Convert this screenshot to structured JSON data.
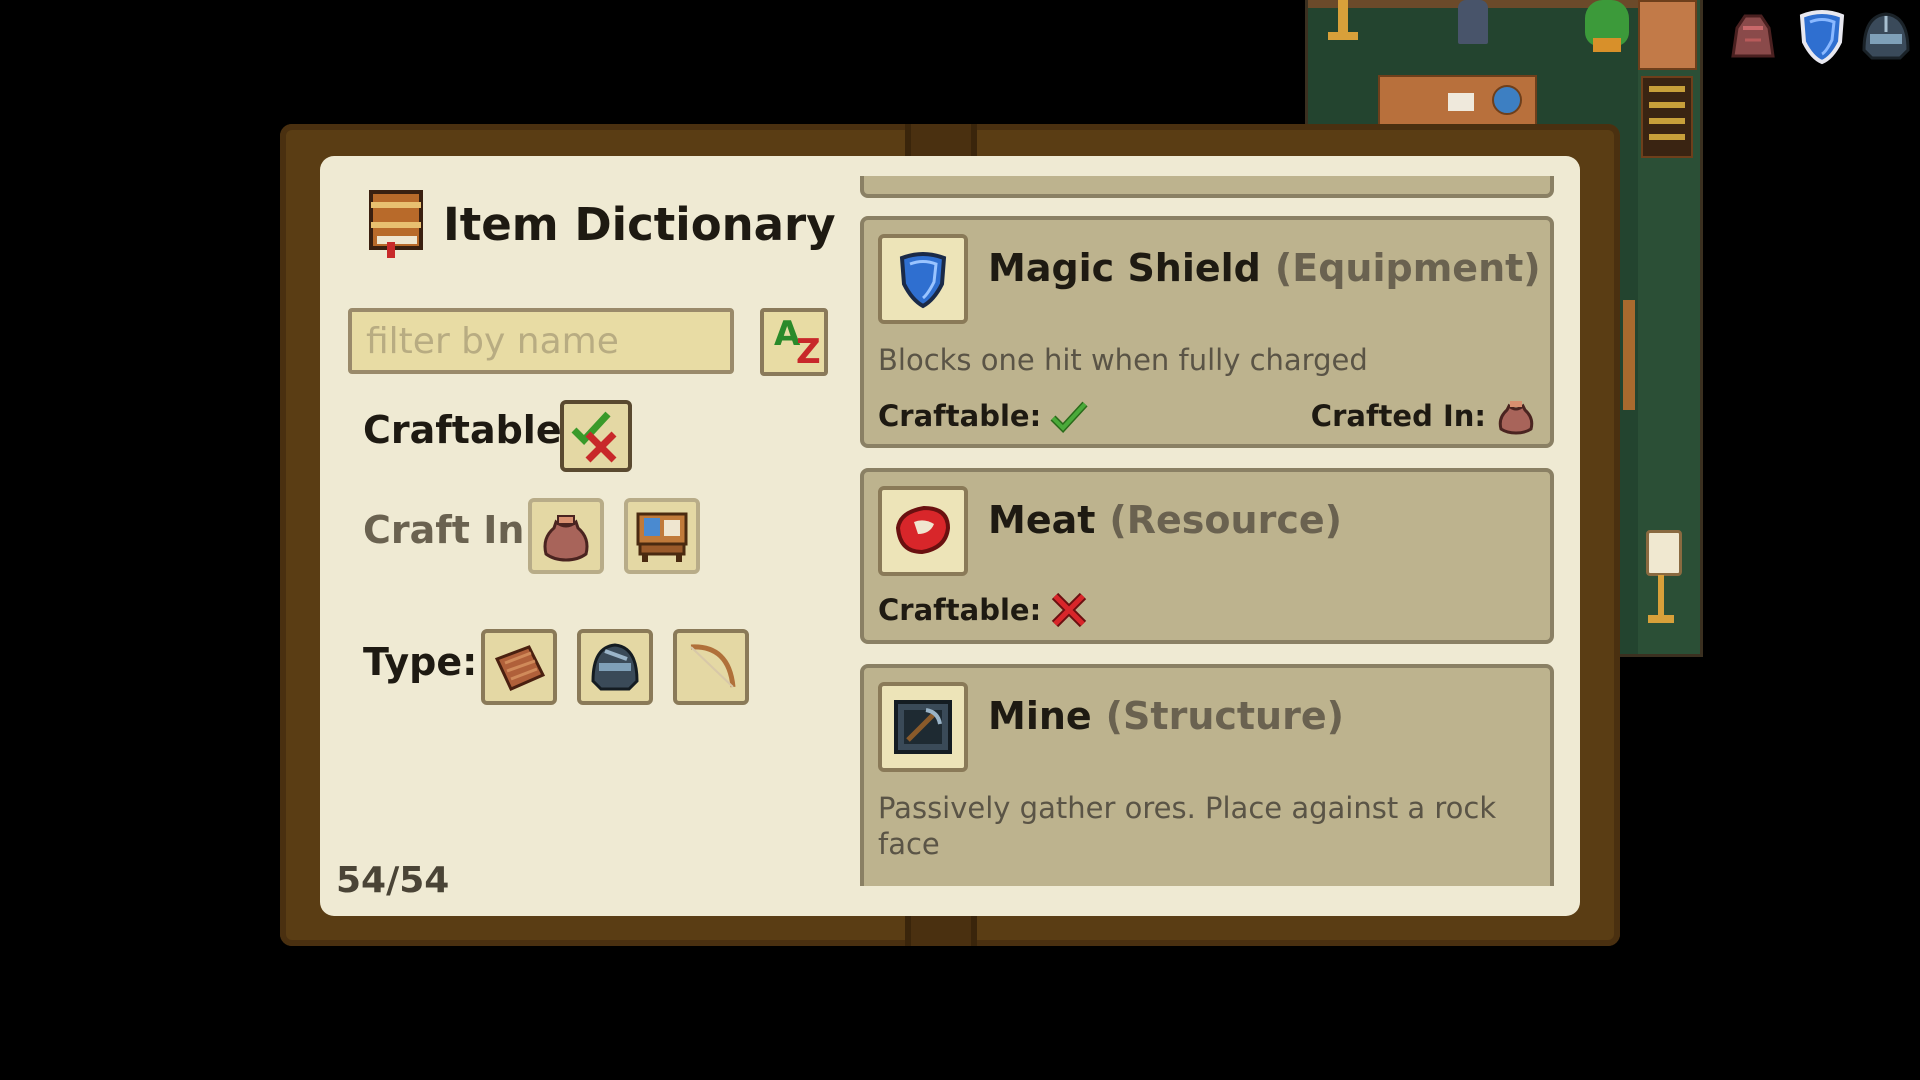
{
  "dictionary": {
    "title": "Item Dictionary",
    "search_placeholder": "filter by name",
    "sort_a": "A",
    "sort_z": "Z",
    "craftable_label": "Craftable:",
    "craft_in_label": "Craft In:",
    "type_label": "Type:",
    "count": "54/54"
  },
  "items": [
    {
      "name": "Magic Shield",
      "type": "(Equipment)",
      "description": "Blocks one hit when fully charged",
      "craftable_label": "Craftable:",
      "craftable": true,
      "crafted_in_label": "Crafted In:",
      "icon": "shield-icon"
    },
    {
      "name": "Meat",
      "type": "(Resource)",
      "craftable_label": "Craftable:",
      "craftable": false,
      "icon": "meat-icon"
    },
    {
      "name": "Mine",
      "type": "(Structure)",
      "description": "Passively gather ores. Place against a rock face",
      "icon": "mine-icon"
    }
  ],
  "colors": {
    "book_frame": "#5a3d14",
    "page": "#efead3",
    "card": "#bdb38e",
    "check_green": "#3a9a2a",
    "cross_red": "#c8282a"
  }
}
